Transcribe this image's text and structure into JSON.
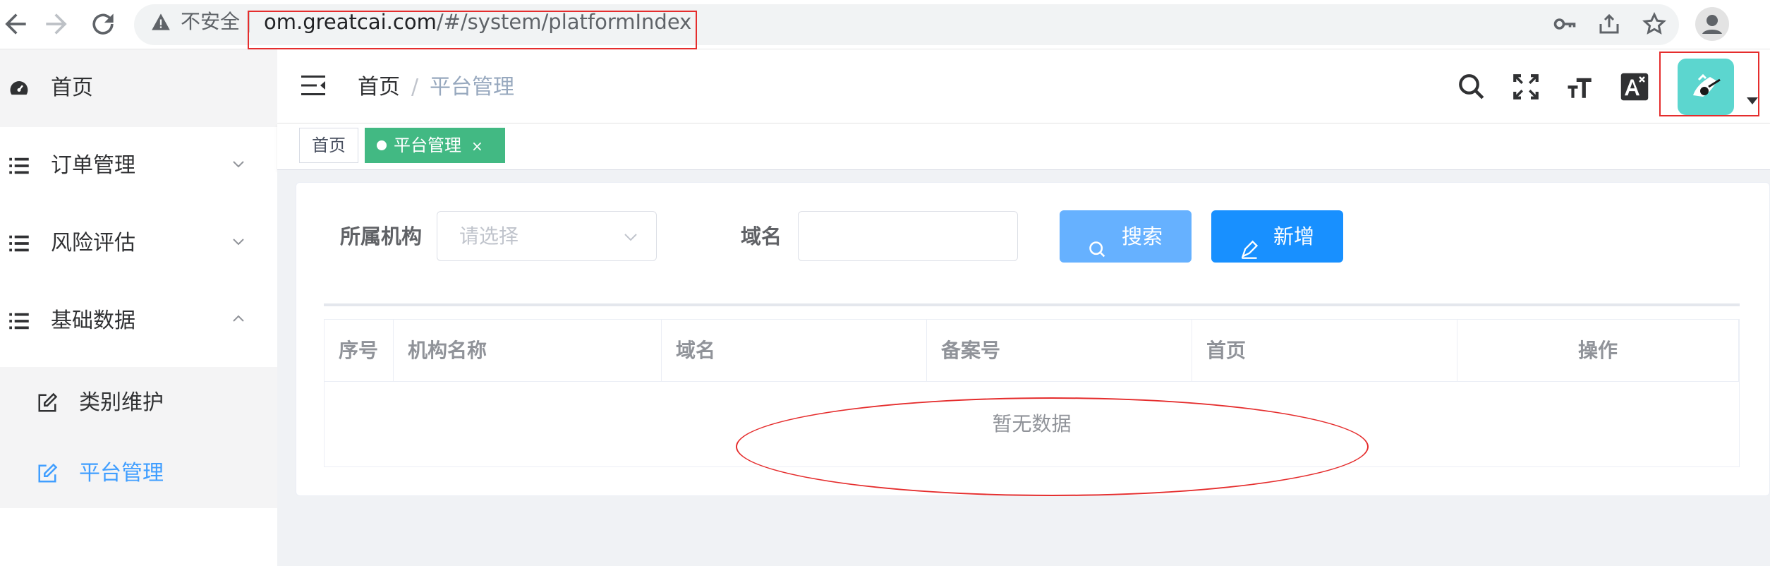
{
  "browser": {
    "insecure_label": "不安全",
    "url_domain": "om.greatcai.com",
    "url_rest": "/#/system/platformIndex"
  },
  "sidebar": {
    "items": [
      {
        "label": "首页",
        "icon": "dashboard-icon"
      },
      {
        "label": "订单管理",
        "icon": "list-icon",
        "expanded": false
      },
      {
        "label": "风险评估",
        "icon": "list-icon",
        "expanded": false
      },
      {
        "label": "基础数据",
        "icon": "list-icon",
        "expanded": true
      }
    ],
    "submenu": [
      {
        "label": "类别维护",
        "icon": "edit-icon",
        "active": false
      },
      {
        "label": "平台管理",
        "icon": "edit-icon",
        "active": true
      }
    ]
  },
  "header": {
    "breadcrumb": {
      "home": "首页",
      "separator": "/",
      "current": "平台管理"
    }
  },
  "tags": {
    "home": "首页",
    "active": "平台管理",
    "close": "×"
  },
  "search_form": {
    "org_label": "所属机构",
    "org_placeholder": "请选择",
    "domain_label": "域名",
    "domain_value": "",
    "search_button": "搜索",
    "add_button": "新增"
  },
  "table": {
    "columns": [
      "序号",
      "机构名称",
      "域名",
      "备案号",
      "首页",
      "操作"
    ],
    "rows": [],
    "empty_text": "暂无数据"
  },
  "colors": {
    "primary": "#409eff",
    "tag_active": "#42b983",
    "search_button": "#66b1ff",
    "add_button": "#1890ff",
    "annotation": "#e52d2d",
    "avatar": "#5cd6cf"
  }
}
